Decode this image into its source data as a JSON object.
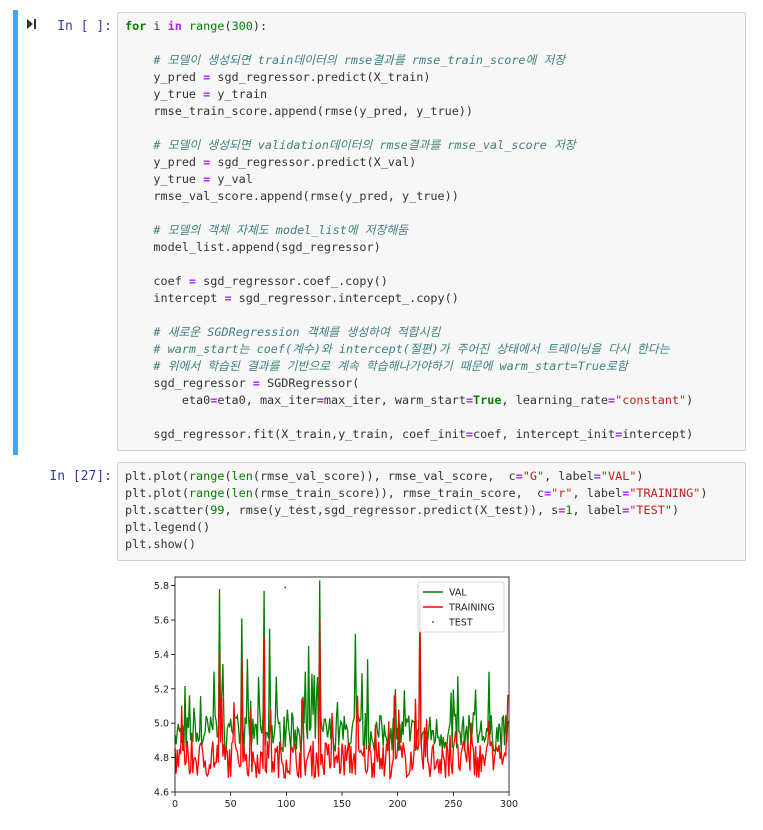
{
  "cell1": {
    "prompt": "In [ ]:",
    "lines": [
      [
        [
          "kw",
          "for"
        ],
        [
          "t",
          " i "
        ],
        [
          "op",
          "in"
        ],
        [
          "t",
          " "
        ],
        [
          "bi",
          "range"
        ],
        [
          "t",
          "("
        ],
        [
          "num",
          "300"
        ],
        [
          "t",
          "):"
        ]
      ],
      [
        [
          "t",
          ""
        ]
      ],
      [
        [
          "t",
          "    "
        ],
        [
          "cm",
          "# 모델이 생성되면 train데이터의 rmse결과를 rmse_train_score에 저장"
        ]
      ],
      [
        [
          "t",
          "    y_pred "
        ],
        [
          "op",
          "="
        ],
        [
          "t",
          " sgd_regressor.predict(X_train)"
        ]
      ],
      [
        [
          "t",
          "    y_true "
        ],
        [
          "op",
          "="
        ],
        [
          "t",
          " y_train"
        ]
      ],
      [
        [
          "t",
          "    rmse_train_score.append(rmse(y_pred, y_true))"
        ]
      ],
      [
        [
          "t",
          ""
        ]
      ],
      [
        [
          "t",
          "    "
        ],
        [
          "cm",
          "# 모델이 생성되면 validation데이터의 rmse결과를 rmse_val_score 저장"
        ]
      ],
      [
        [
          "t",
          "    y_pred "
        ],
        [
          "op",
          "="
        ],
        [
          "t",
          " sgd_regressor.predict(X_val)"
        ]
      ],
      [
        [
          "t",
          "    y_true "
        ],
        [
          "op",
          "="
        ],
        [
          "t",
          " y_val"
        ]
      ],
      [
        [
          "t",
          "    rmse_val_score.append(rmse(y_pred, y_true))"
        ]
      ],
      [
        [
          "t",
          ""
        ]
      ],
      [
        [
          "t",
          "    "
        ],
        [
          "cm",
          "# 모델의 객체 자체도 model_list에 저장해둠"
        ]
      ],
      [
        [
          "t",
          "    model_list.append(sgd_regressor)"
        ]
      ],
      [
        [
          "t",
          ""
        ]
      ],
      [
        [
          "t",
          "    coef "
        ],
        [
          "op",
          "="
        ],
        [
          "t",
          " sgd_regressor.coef_.copy()"
        ]
      ],
      [
        [
          "t",
          "    intercept "
        ],
        [
          "op",
          "="
        ],
        [
          "t",
          " sgd_regressor.intercept_.copy()"
        ]
      ],
      [
        [
          "t",
          ""
        ]
      ],
      [
        [
          "t",
          "    "
        ],
        [
          "cm",
          "# 새로운 SGDRegression 객체를 생성하여 적합시킴"
        ]
      ],
      [
        [
          "t",
          "    "
        ],
        [
          "cm",
          "# warm_start는 coef(계수)와 intercept(절편)가 주어진 상태에서 트레이닝을 다시 한다는"
        ]
      ],
      [
        [
          "t",
          "    "
        ],
        [
          "cm",
          "# 위에서 학습된 결과를 기반으로 계속 학습해나가야하기 때문에 warm_start=True로함"
        ]
      ],
      [
        [
          "t",
          "    sgd_regressor "
        ],
        [
          "op",
          "="
        ],
        [
          "t",
          " SGDRegressor("
        ]
      ],
      [
        [
          "t",
          "        eta0"
        ],
        [
          "op",
          "="
        ],
        [
          "t",
          "eta0, max_iter"
        ],
        [
          "op",
          "="
        ],
        [
          "t",
          "max_iter, warm_start"
        ],
        [
          "op",
          "="
        ],
        [
          "kw",
          "True"
        ],
        [
          "t",
          ", learning_rate"
        ],
        [
          "op",
          "="
        ],
        [
          "str",
          "\"constant\""
        ],
        [
          "t",
          ")"
        ]
      ],
      [
        [
          "t",
          ""
        ]
      ],
      [
        [
          "t",
          "    sgd_regressor.fit(X_train,y_train, coef_init"
        ],
        [
          "op",
          "="
        ],
        [
          "t",
          "coef, intercept_init"
        ],
        [
          "op",
          "="
        ],
        [
          "t",
          "intercept)"
        ]
      ]
    ]
  },
  "cell2": {
    "prompt": "In [27]:",
    "lines": [
      [
        [
          "t",
          "plt.plot("
        ],
        [
          "bi",
          "range"
        ],
        [
          "t",
          "("
        ],
        [
          "bi",
          "len"
        ],
        [
          "t",
          "(rmse_val_score)), rmse_val_score,  c"
        ],
        [
          "op",
          "="
        ],
        [
          "str",
          "\"G\""
        ],
        [
          "t",
          ", label"
        ],
        [
          "op",
          "="
        ],
        [
          "str",
          "\"VAL\""
        ],
        [
          "t",
          ")"
        ]
      ],
      [
        [
          "t",
          "plt.plot("
        ],
        [
          "bi",
          "range"
        ],
        [
          "t",
          "("
        ],
        [
          "bi",
          "len"
        ],
        [
          "t",
          "(rmse_train_score)), rmse_train_score,  c"
        ],
        [
          "op",
          "="
        ],
        [
          "str",
          "\"r\""
        ],
        [
          "t",
          ", label"
        ],
        [
          "op",
          "="
        ],
        [
          "str",
          "\"TRAINING\""
        ],
        [
          "t",
          ")"
        ]
      ],
      [
        [
          "t",
          "plt.scatter("
        ],
        [
          "num",
          "99"
        ],
        [
          "t",
          ", rmse(y_test,sgd_regressor.predict(X_test)), s"
        ],
        [
          "op",
          "="
        ],
        [
          "num",
          "1"
        ],
        [
          "t",
          ", label"
        ],
        [
          "op",
          "="
        ],
        [
          "str",
          "\"TEST\""
        ],
        [
          "t",
          ")"
        ]
      ],
      [
        [
          "t",
          "plt.legend()"
        ]
      ],
      [
        [
          "t",
          "plt.show()"
        ]
      ]
    ]
  },
  "chart_data": {
    "type": "line",
    "xlim": [
      0,
      300
    ],
    "ylim": [
      4.6,
      5.85
    ],
    "xticks": [
      "0",
      "50",
      "100",
      "150",
      "200",
      "250",
      "300"
    ],
    "yticks": [
      "4.6",
      "4.8",
      "5.0",
      "5.2",
      "5.4",
      "5.6",
      "5.8"
    ],
    "legend_position": "top-right",
    "series": [
      {
        "name": "VAL",
        "color": "#008000",
        "kind": "line",
        "n": 300,
        "baseline": 4.93,
        "spikes": [
          [
            40,
            5.78
          ],
          [
            80,
            5.77
          ],
          [
            130,
            5.83
          ],
          [
            60,
            5.61
          ],
          [
            220,
            5.72
          ],
          [
            35,
            5.3
          ],
          [
            85,
            5.55
          ],
          [
            162,
            5.52
          ],
          [
            120,
            5.45
          ]
        ]
      },
      {
        "name": "TRAINING",
        "color": "#ff0000",
        "kind": "line",
        "n": 300,
        "baseline": 4.78,
        "spikes": [
          [
            130,
            5.6
          ],
          [
            80,
            5.5
          ],
          [
            220,
            5.62
          ],
          [
            40,
            5.43
          ],
          [
            60,
            5.38
          ]
        ]
      },
      {
        "name": "TEST",
        "color": "#1f77b4",
        "kind": "scatter",
        "points": [
          [
            99,
            5.79
          ]
        ]
      }
    ]
  }
}
